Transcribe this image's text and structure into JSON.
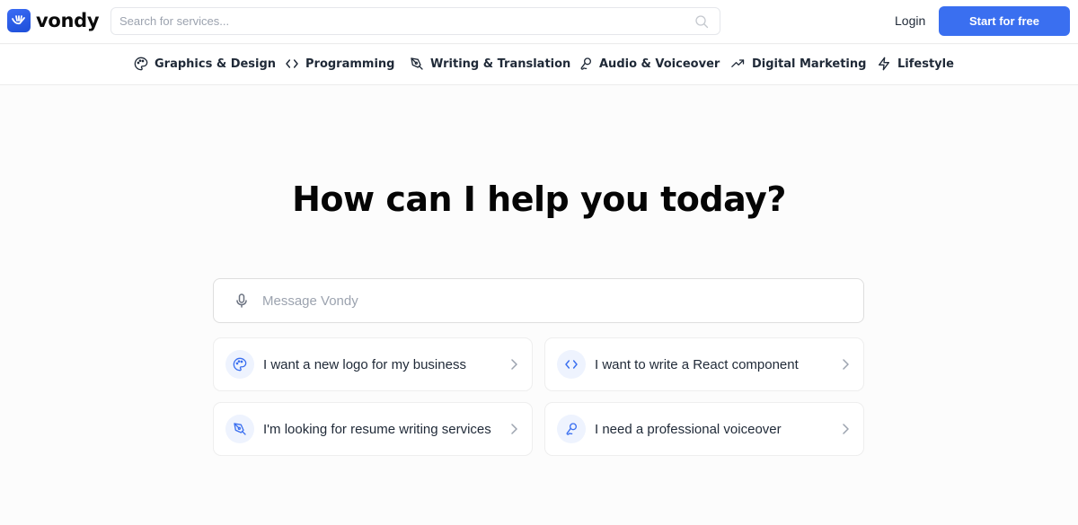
{
  "header": {
    "brand": "vondy",
    "search_placeholder": "Search for services...",
    "login_label": "Login",
    "start_label": "Start for free",
    "accent_color": "#3a6ff0"
  },
  "categories": [
    {
      "label": "Graphics & Design",
      "icon": "palette-icon"
    },
    {
      "label": "Programming",
      "icon": "code-icon"
    },
    {
      "label": "Writing & Translation",
      "icon": "pen-nib-icon"
    },
    {
      "label": "Audio & Voiceover",
      "icon": "microphone-icon"
    },
    {
      "label": "Digital Marketing",
      "icon": "trending-up-icon"
    },
    {
      "label": "Lifestyle",
      "icon": "lightning-icon"
    }
  ],
  "hero": {
    "title": "How can I help you today?",
    "message_placeholder": "Message Vondy"
  },
  "suggestions": [
    {
      "label": "I want a new logo for my business",
      "icon": "palette-icon"
    },
    {
      "label": "I want to write a React component",
      "icon": "code-icon"
    },
    {
      "label": "I'm looking for resume writing services",
      "icon": "pen-nib-icon"
    },
    {
      "label": "I need a professional voiceover",
      "icon": "microphone-icon"
    }
  ]
}
